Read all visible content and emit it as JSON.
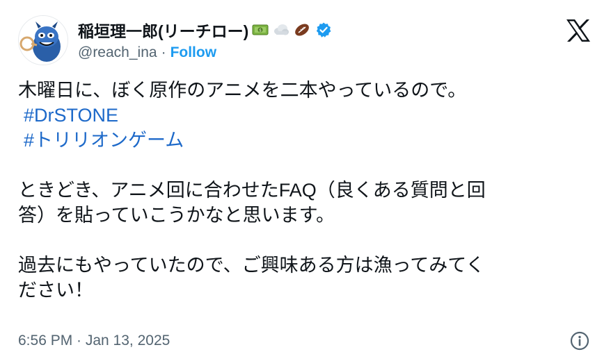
{
  "author": {
    "display_name": "稲垣理一郎(リーチロー)",
    "handle": "@reach_ina",
    "separator": "·",
    "follow_label": "Follow",
    "badges": [
      "money-icon",
      "cloud-icon",
      "football-icon"
    ],
    "verified": true,
    "verified_color": "#1d9bf0"
  },
  "brand": {
    "logo": "x-logo-icon"
  },
  "tweet": {
    "line1": "木曜日に、ぼく原作のアニメを二本やっているので。",
    "hashtags": [
      "#DrSTONE",
      "#トリリオンゲーム"
    ],
    "paragraph2_line1": "ときどき、アニメ回に合わせたFAQ（良くある質問と回",
    "paragraph2_line2": "答）を貼っていこうかなと思います。",
    "paragraph3_line1": "過去にもやっていたので、ご興味ある方は漁ってみてく",
    "paragraph3_line2": "ださい！"
  },
  "footer": {
    "timestamp": "6:56 PM · Jan 13, 2025",
    "info_icon": "info-icon"
  },
  "colors": {
    "link": "#1d9bf0",
    "hashtag": "#1d69c9",
    "muted": "#536471",
    "text": "#0f1419"
  }
}
